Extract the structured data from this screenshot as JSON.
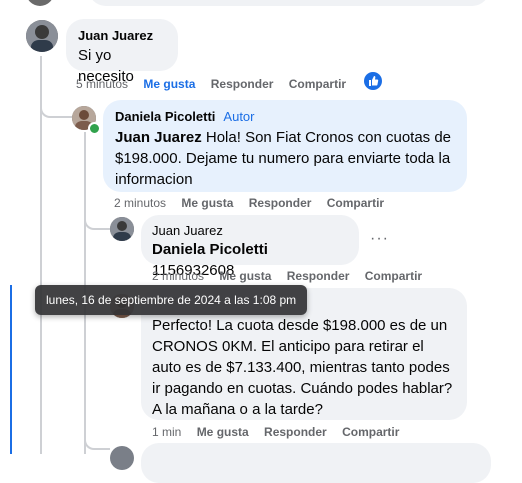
{
  "comments": [
    {
      "author": "Juan Juarez",
      "text": "Si yo necesito",
      "time": "5 minutos",
      "like": "Me gusta",
      "reply": "Responder",
      "share": "Compartir"
    },
    {
      "author": "Daniela Picoletti",
      "badge": "Autor",
      "mention": "Juan Juarez",
      "text": " Hola! Son Fiat Cronos con cuotas de $198.000. Dejame tu numero para enviarte toda la informacion",
      "time": "2 minutos",
      "like": "Me gusta",
      "reply": "Responder",
      "share": "Compartir"
    },
    {
      "author": "Juan Juarez",
      "mention": "Daniela Picoletti",
      "text": " 1156932608",
      "time": "2 minutos",
      "like": "Me gusta",
      "reply": "Responder",
      "share": "Compartir",
      "more": "···"
    },
    {
      "text": "Perfecto! La cuota desde $198.000 es de un CRONOS 0KM. El anticipo para retirar el auto es de $7.133.400, mientras tanto podes ir pagando en cuotas. Cuándo podes hablar? A la mañana o a la tarde?",
      "time": "1 min",
      "like": "Me gusta",
      "reply": "Responder",
      "share": "Compartir"
    }
  ],
  "tooltip": "lunes, 16 de septiembre de 2024 a las 1:08 pm",
  "colors": {
    "accent": "#1b6ee5",
    "bubble": "#f0f2f5",
    "author_bubble": "#e7f1fd",
    "meta": "#65676b",
    "online": "#31a24c"
  }
}
